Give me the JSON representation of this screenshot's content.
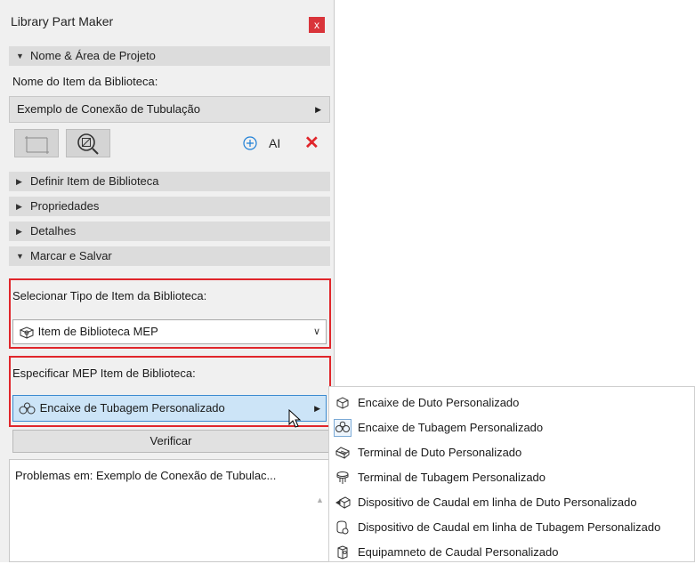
{
  "window": {
    "title": "Library Part Maker",
    "close_glyph": "x"
  },
  "sections": {
    "nome": "Nome & Área de Projeto",
    "definir": "Definir Item de Biblioteca",
    "propriedades": "Propriedades",
    "detalhes": "Detalhes",
    "marcar": "Marcar e Salvar"
  },
  "nome_area": {
    "item_label": "Nome do Item da Biblioteca:",
    "item_value": "Exemplo de Conexão de Tubulação"
  },
  "toolbar": {
    "rename_glyph": "AI",
    "delete_glyph": "✕",
    "accent": "#1e7fd6",
    "danger": "#e0262b"
  },
  "marcar": {
    "tipo_label": "Selecionar Tipo de Item da Biblioteca:",
    "tipo_value": "Item de Biblioteca MEP",
    "mep_label": "Especificar MEP Item de Biblioteca:",
    "mep_value": "Encaixe de Tubagem Personalizado",
    "verify_label": "Verificar"
  },
  "problems": {
    "text": "Problemas em: Exemplo de Conexão de Tubulac..."
  },
  "submenu": {
    "items": [
      {
        "label": "Encaixe de Duto Personalizado",
        "icon": "duct-fitting-icon"
      },
      {
        "label": "Encaixe de Tubagem Personalizado",
        "icon": "pipe-fitting-icon"
      },
      {
        "label": "Terminal de Duto Personalizado",
        "icon": "duct-terminal-icon"
      },
      {
        "label": "Terminal de Tubagem Personalizado",
        "icon": "pipe-terminal-icon"
      },
      {
        "label": "Dispositivo de Caudal em linha de Duto Personalizado",
        "icon": "duct-inline-flow-icon"
      },
      {
        "label": "Dispositivo de Caudal em linha de Tubagem Personalizado",
        "icon": "pipe-inline-flow-icon"
      },
      {
        "label": "Equipamneto de Caudal Personalizado",
        "icon": "flow-equipment-icon"
      }
    ]
  },
  "colors": {
    "highlight_border": "#e0262b",
    "selection_bg": "#cce4f7",
    "selection_border": "#3c8bd0"
  }
}
